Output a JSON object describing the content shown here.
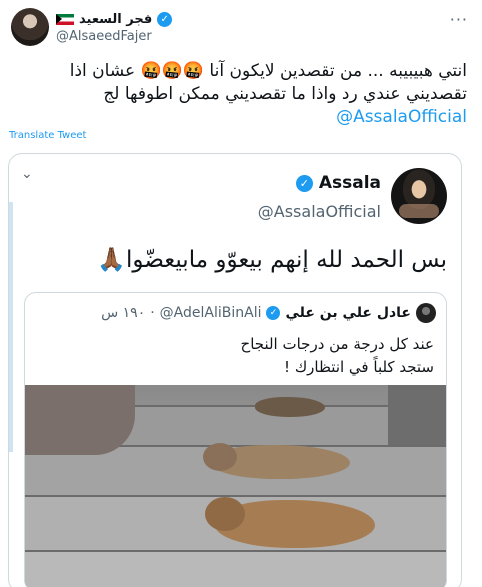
{
  "author": {
    "display_name": "فجر السعيد",
    "handle": "@AlsaeedFajer",
    "more_icon": "more-dots-icon"
  },
  "tweet": {
    "line1": "انتي هبيبيبه ... من تقصدين لايكون آنا 🤬🤬🤬 عشان اذا",
    "line2": "تقصديني عندي رد واذا ما تقصديني ممكن اطوفها لج",
    "mention": "@AssalaOfficial",
    "translate_label": "Translate Tweet"
  },
  "quoted": {
    "display_name": "Assala",
    "handle": "@AssalaOfficial",
    "text": "بس الحمد لله إنهم بيعوّو مابيعضّوا🙏🏾"
  },
  "nested_quote": {
    "display_name": "عادل علي بن علي",
    "handle": "@AdelAliBinAli",
    "time": "١٩٠ س",
    "separator": "·",
    "line1": "عند كل درجة من درجات النجاح",
    "line2": "ستجد كلباً في انتظارك !"
  },
  "colors": {
    "accent": "#1d9bf0",
    "text": "#0f1419",
    "muted": "#536471",
    "border": "#cfd9de"
  }
}
